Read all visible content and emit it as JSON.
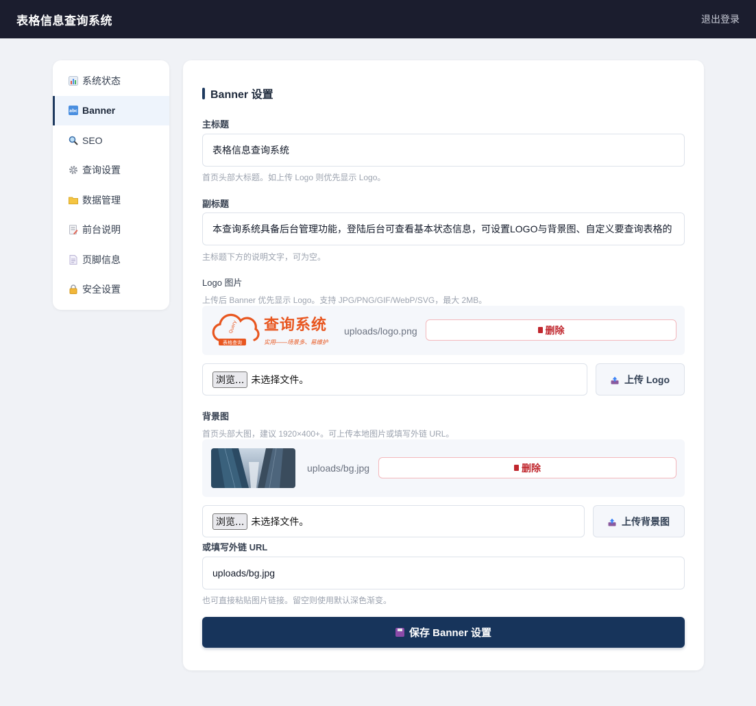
{
  "header": {
    "title": "表格信息查询系统",
    "logout_label": "退出登录"
  },
  "sidebar": {
    "items": [
      {
        "label": "系统状态",
        "icon": "bar-chart-icon"
      },
      {
        "label": "Banner",
        "icon": "abc-icon",
        "active": true
      },
      {
        "label": "SEO",
        "icon": "magnifier-icon"
      },
      {
        "label": "查询设置",
        "icon": "gear-icon"
      },
      {
        "label": "数据管理",
        "icon": "folder-icon"
      },
      {
        "label": "前台说明",
        "icon": "memo-icon"
      },
      {
        "label": "页脚信息",
        "icon": "page-icon"
      },
      {
        "label": "安全设置",
        "icon": "lock-icon"
      }
    ]
  },
  "main": {
    "section_title": "Banner 设置",
    "title_field": {
      "label": "主标题",
      "value": "表格信息查询系统",
      "hint": "首页头部大标题。如上传 Logo 则优先显示 Logo。"
    },
    "subtitle_field": {
      "label": "副标题",
      "value": "本查询系统具备后台管理功能，登陆后台可查看基本状态信息，可设置LOGO与背景图、自定义要查询表格的",
      "hint": "主标题下方的说明文字，可为空。"
    },
    "logo": {
      "label": "Logo 图片",
      "hint": "上传后 Banner 优先显示 Logo。支持 JPG/PNG/GIF/WebP/SVG，最大 2MB。",
      "logo_text": "查询系统",
      "logo_tagline": "实用——场景多、易维护",
      "logo_badge": "表格查询",
      "logo_query": "Query",
      "path": "uploads/logo.png",
      "delete_label": "删除",
      "browse_label": "浏览...",
      "no_file_label": "未选择文件。",
      "upload_label": "上传 Logo"
    },
    "background": {
      "label": "背景图",
      "hint": "首页头部大图，建议 1920×400+。可上传本地图片或填写外链 URL。",
      "path": "uploads/bg.jpg",
      "delete_label": "删除",
      "browse_label": "浏览...",
      "no_file_label": "未选择文件。",
      "upload_label": "上传背景图"
    },
    "url_field": {
      "label": "或填写外链 URL",
      "value": "uploads/bg.jpg",
      "hint": "也可直接粘贴图片链接。留空则使用默认深色渐变。"
    },
    "save_label": "保存 Banner 设置"
  },
  "colors": {
    "topbar": "#1b1d2e",
    "primary": "#17345b",
    "danger": "#c0262d",
    "logo_orange": "#e8561f"
  }
}
